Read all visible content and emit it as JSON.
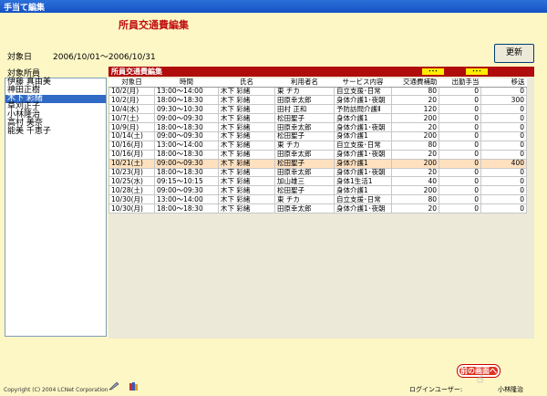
{
  "window": {
    "title": "手当て編集"
  },
  "page": {
    "title": "所員交通費編集",
    "period_label": "対象日",
    "period_value": "2006/10/01～2006/10/31",
    "update_button": "更新"
  },
  "staff": {
    "label": "対象所員",
    "items": [
      "伊藤 真由美",
      "神田正樹",
      "木下 彩緒",
      "草刈正子",
      "小林隆治",
      "高村 美奈",
      "能美 千恵子"
    ],
    "selected_index": 2
  },
  "panel": {
    "header": "所員交通費編集",
    "dots_1": "･･･",
    "dots_2": "･･･"
  },
  "table": {
    "columns": [
      "対象日",
      "時間",
      "氏名",
      "利用者名",
      "サービス内容",
      "交通費補助",
      "出勤手当",
      "移送"
    ],
    "rows": [
      [
        "10/2(月)",
        "13:00～14:00",
        "木下 彩緒",
        "東 チカ",
        "自立支援･日常",
        "80",
        "0",
        "0"
      ],
      [
        "10/2(月)",
        "18:00～18:30",
        "木下 彩緒",
        "田原幸太郎",
        "身体介護1･夜朝",
        "20",
        "0",
        "300"
      ],
      [
        "10/4(水)",
        "09:30～10:30",
        "木下 彩緒",
        "田村 正和",
        "予防訪問介護Ⅱ",
        "120",
        "0",
        "0"
      ],
      [
        "10/7(土)",
        "09:00～09:30",
        "木下 彩緒",
        "松田聖子",
        "身体介護1",
        "200",
        "0",
        "0"
      ],
      [
        "10/9(月)",
        "18:00～18:30",
        "木下 彩緒",
        "田原幸太郎",
        "身体介護1･夜朝",
        "20",
        "0",
        "0"
      ],
      [
        "10/14(土)",
        "09:00～09:30",
        "木下 彩緒",
        "松田聖子",
        "身体介護1",
        "200",
        "0",
        "0"
      ],
      [
        "10/16(月)",
        "13:00～14:00",
        "木下 彩緒",
        "東 チカ",
        "自立支援･日常",
        "80",
        "0",
        "0"
      ],
      [
        "10/16(月)",
        "18:00～18:30",
        "木下 彩緒",
        "田原幸太郎",
        "身体介護1･夜朝",
        "20",
        "0",
        "0"
      ],
      [
        "10/21(土)",
        "09:00～09:30",
        "木下 彩緒",
        "松田聖子",
        "身体介護1",
        "200",
        "0",
        "400"
      ],
      [
        "10/23(月)",
        "18:00～18:30",
        "木下 彩緒",
        "田原幸太郎",
        "身体介護1･夜朝",
        "20",
        "0",
        "0"
      ],
      [
        "10/25(水)",
        "09:15～10:15",
        "木下 彩緒",
        "加山雄三",
        "身体1生活1",
        "40",
        "0",
        "0"
      ],
      [
        "10/28(土)",
        "09:00～09:30",
        "木下 彩緒",
        "松田聖子",
        "身体介護1",
        "200",
        "0",
        "0"
      ],
      [
        "10/30(月)",
        "13:00～14:00",
        "木下 彩緒",
        "東 チカ",
        "自立支援･日常",
        "80",
        "0",
        "0"
      ],
      [
        "10/30(月)",
        "18:00～18:30",
        "木下 彩緒",
        "田原幸太郎",
        "身体介護1･夜朝",
        "20",
        "0",
        "0"
      ]
    ],
    "highlight_index": 8
  },
  "footer": {
    "copyright": "Copyright (C) 2004 LCNet Corporation",
    "login_label": "ログインユーザー:",
    "login_value": "小林隆治",
    "back_button": "前の画面へ"
  },
  "colors": {
    "background": "#fdf7c6",
    "panel_header": "#b00c0c",
    "title_red": "#c01010",
    "selected": "#316ac5",
    "highlight_row": "#ffe1c0"
  },
  "icons": [
    "pen-icon",
    "books-icon",
    "hand-cursor-icon"
  ]
}
